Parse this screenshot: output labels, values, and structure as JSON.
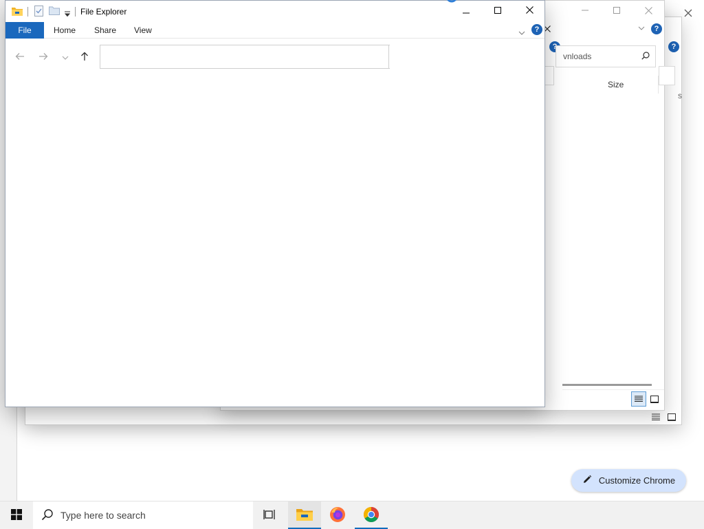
{
  "main_window": {
    "title": "File Explorer",
    "tabs": [
      "File",
      "Home",
      "Share",
      "View"
    ]
  },
  "background_window": {
    "search_placeholder": "vnloads",
    "column_size": "Size"
  },
  "chrome": {
    "customize_label": "Customize Chrome"
  },
  "taskbar": {
    "search_placeholder": "Type here to search"
  },
  "colors": {
    "accent": "#1a68bd",
    "customize_bg": "#d3e3fd"
  }
}
